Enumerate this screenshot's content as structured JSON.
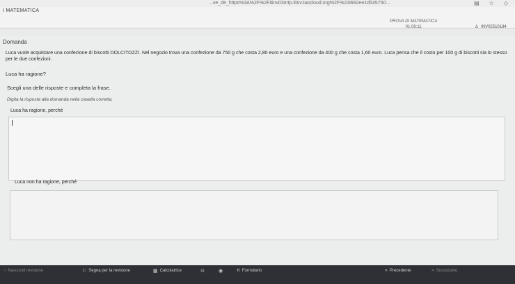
{
  "browser": {
    "url": "...ve_de_https%3A%2F%2Fitinv03mtp.itinv.taocloud.org%2F%23i682ee1d535750..."
  },
  "header": {
    "app_title": "I MATEMATICA",
    "test_name": "PROVA DI MATEMATICA",
    "timer": "01:08:11",
    "user_code": "INV02510184"
  },
  "question": {
    "section_title": "Domanda",
    "text": "Luca vuole acquistare una confezione di biscotti DOLCITOZZI. Nel negozio trova una confezione da 750 g che costa 2,80 euro e una confezione da 400 g che costa 1,60 euro. Luca pensa che il costo per 100 g di biscotti sia lo stesso per le due confezioni.",
    "ask": "Luca ha ragione?",
    "instruction": "Scegli una delle risposte e completa la frase.",
    "instruction_hint": "Digita la risposta alla domanda nella casella corretta."
  },
  "answers": {
    "label_yes": "Luca ha ragione, perché",
    "value_yes": "",
    "label_no": "Luca non ha ragione, perché",
    "value_no": ""
  },
  "footer": {
    "hide_review": "Nascondi revisione",
    "mark_review": "Segna per la revisione",
    "calculator": "Calcolatrice",
    "formulas": "Formulario",
    "previous": "Precedente",
    "next": "Successivo"
  }
}
